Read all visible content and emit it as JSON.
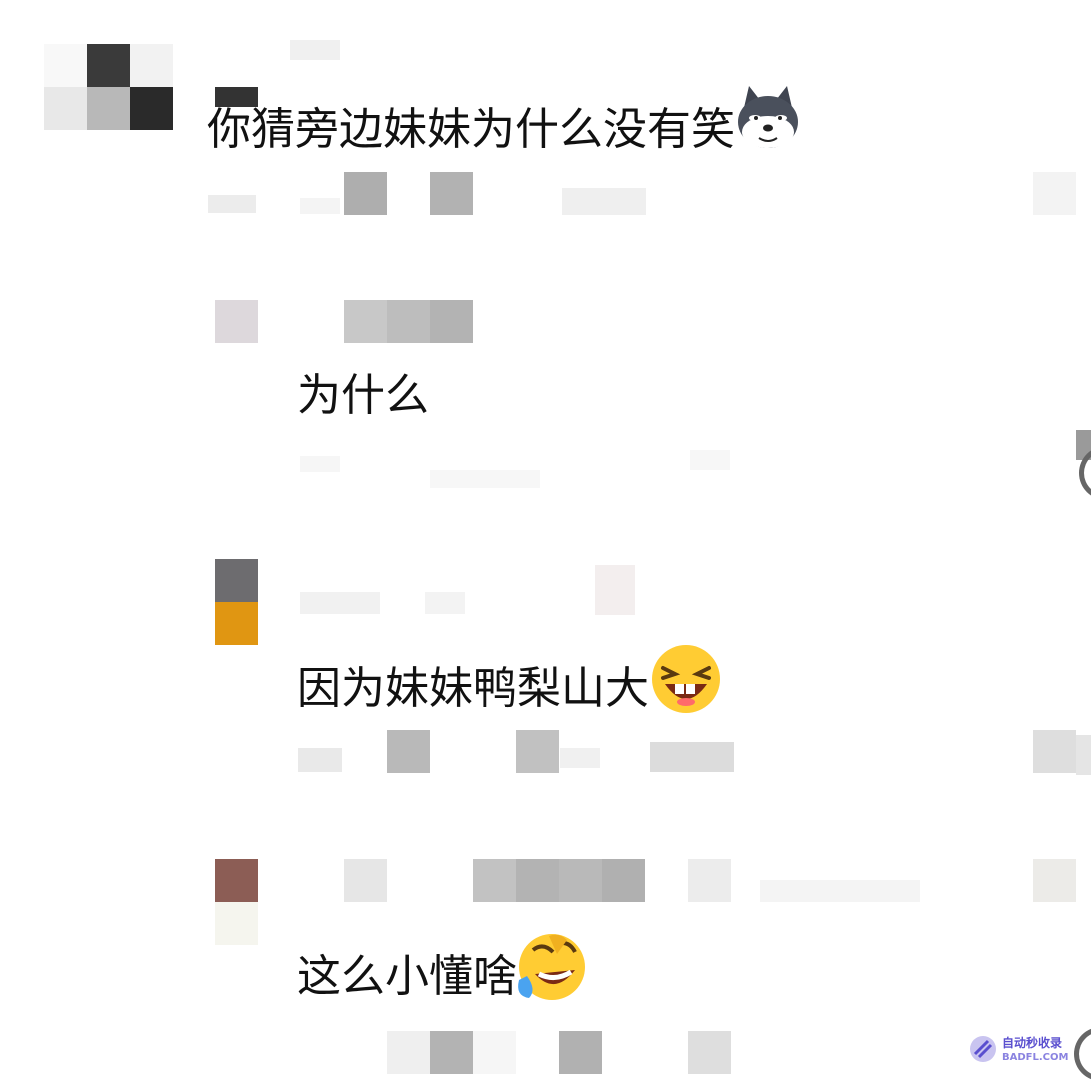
{
  "comments": [
    {
      "text": "你猜旁边妹妹为什么没有笑",
      "emoji": "doge-husky-icon"
    },
    {
      "text": "为什么",
      "emoji": ""
    },
    {
      "text": "因为妹妹鸭梨山大",
      "emoji": "laughing-face-icon"
    },
    {
      "text": "这么小懂啥",
      "emoji": "rofl-face-icon"
    }
  ],
  "watermark": {
    "title": "自动秒收录",
    "url": "BADFL.COM"
  },
  "colors": {
    "mosaic_dark": "#2e2e2e",
    "mosaic_mid": "#a8a8a8",
    "mosaic_light": "#e6e6e6",
    "emoji_yellow": "#ffcc33"
  }
}
